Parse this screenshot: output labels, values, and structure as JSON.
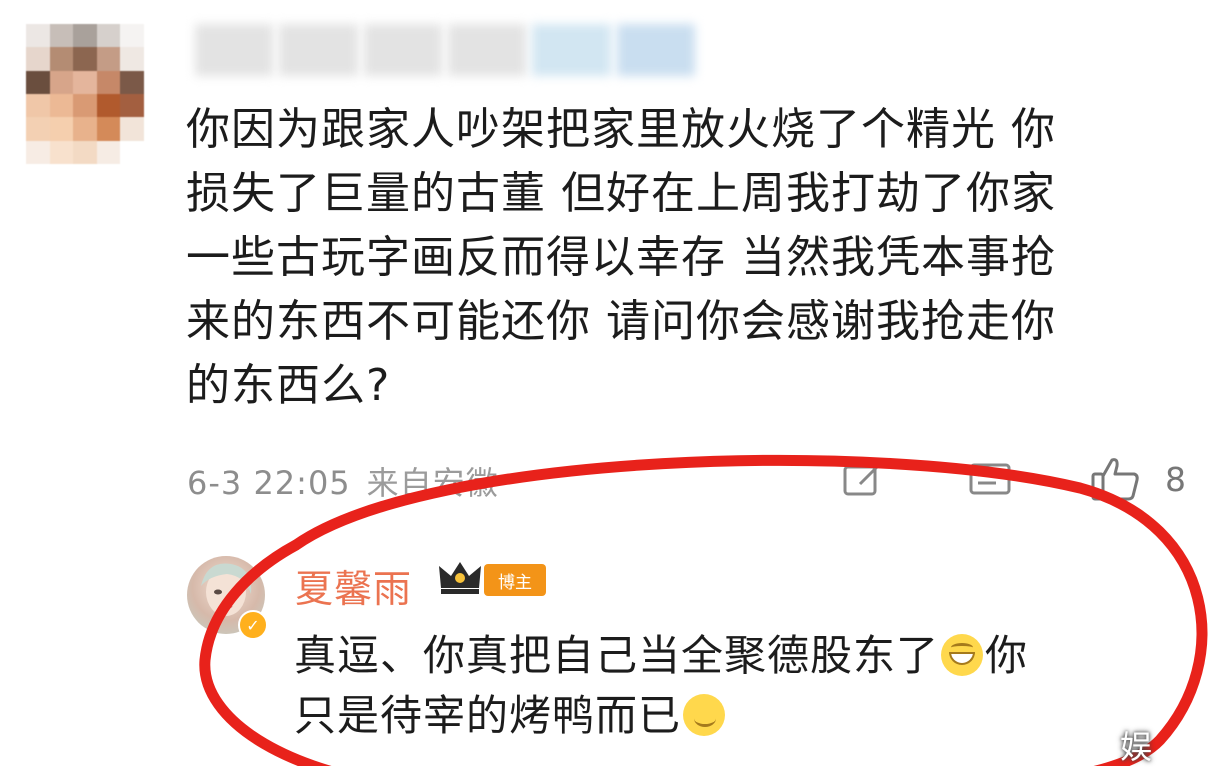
{
  "comment": {
    "lines": [
      "你因为跟家人吵架把家里放火烧了个精光 你",
      "损失了巨量的古董  但好在上周我打劫了你家",
      "一些古玩字画反而得以幸存  当然我凭本事抢",
      "来的东西不可能还你   请问你会感谢我抢走你",
      "的东西么?"
    ],
    "time": "6-3 22:05",
    "source": "来自安徽",
    "like_count": "8"
  },
  "reply": {
    "author": "夏馨雨",
    "badge": "博主",
    "text_part1": "真逗、你真把自己当全聚德股东了",
    "text_part2": "你",
    "text_part3": "只是待宰的烤鸭而已",
    "emoji1": "grin-emoji",
    "emoji2": "wink-emoji"
  },
  "watermark": "娱",
  "colors": {
    "highlight_ring": "#e8221b",
    "author_name": "#eb7350",
    "badge": "#f39418"
  }
}
